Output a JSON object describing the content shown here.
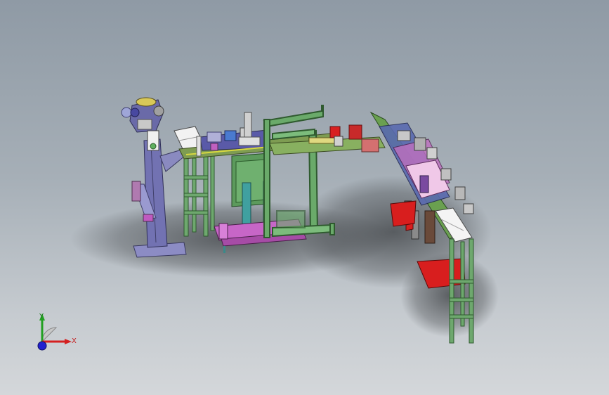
{
  "viewport": {
    "background_top": "#8f9aa5",
    "background_bottom": "#d4d7da"
  },
  "model": {
    "frame_color": "#5c9c5c",
    "column_color": "#7a7ab8",
    "fixture_color": "#cc6acc",
    "safety_color": "#d81e1e",
    "conveyor_color": "#8fbf50"
  },
  "triad": {
    "x_label": "X",
    "y_label": "Y",
    "x_color": "#d42020",
    "y_color": "#22a022",
    "z_color": "#2020d0"
  }
}
